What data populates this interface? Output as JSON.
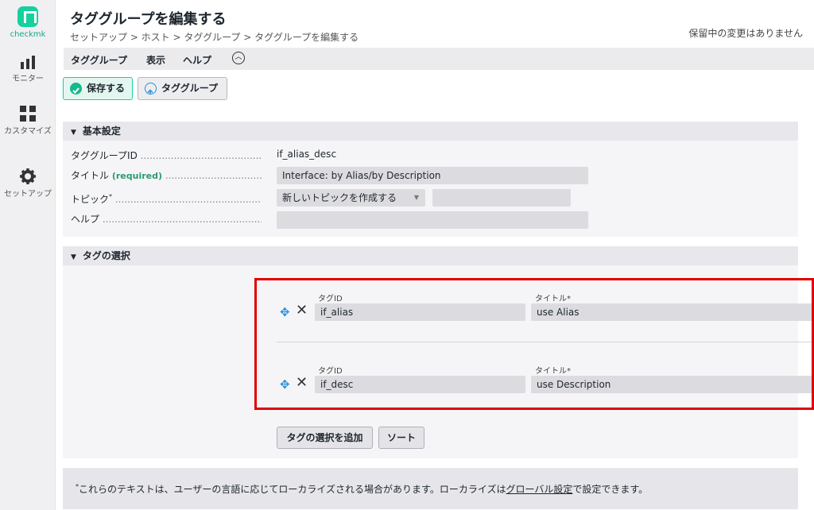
{
  "app": {
    "logo_text": "checkmk"
  },
  "sidebar": {
    "items": [
      {
        "label": "モニター",
        "icon": "bar-chart-icon"
      },
      {
        "label": "カスタマイズ",
        "icon": "grid-icon"
      },
      {
        "label": "セットアップ",
        "icon": "gear-icon"
      }
    ]
  },
  "header": {
    "title": "タググループを編集する",
    "breadcrumb": "セットアップ > ホスト > タググループ > タググループを編集する",
    "pending": "保留中の変更はありません"
  },
  "menu": {
    "items": [
      "タググループ",
      "表示",
      "ヘルプ"
    ]
  },
  "toolbar": {
    "save_label": "保存する",
    "taggroup_label": "タググループ"
  },
  "basic": {
    "heading": "基本設定",
    "id_label": "タググループID",
    "id_value": "if_alias_desc",
    "title_label": "タイトル",
    "required": "(required)",
    "title_value": "Interface: by Alias/by Description",
    "topic_label": "トピック",
    "topic_select": "新しいトピックを作成する",
    "topic_value": "",
    "help_label": "ヘルプ",
    "help_value": ""
  },
  "choices": {
    "heading": "タグの選択",
    "col_id": "タグID",
    "col_title": "タイトル*",
    "rows": [
      {
        "id": "if_alias",
        "title": "use Alias"
      },
      {
        "id": "if_desc",
        "title": "use Description"
      }
    ],
    "add_label": "タグの選択を追加",
    "sort_label": "ソート"
  },
  "footnote": {
    "text": "これらのテキストは、ユーザーの言語に応じてローカライズされる場合があります。ローカライズは",
    "link": "グローバル設定",
    "text_after": "で設定できます。"
  },
  "colors": {
    "accent": "#15d1a0",
    "highlight": "#e00000",
    "move": "#2a8fd6"
  }
}
